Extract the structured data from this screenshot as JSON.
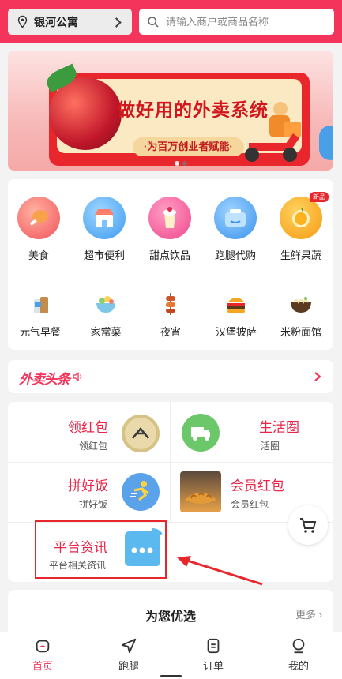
{
  "header": {
    "location": "银河公寓",
    "search_placeholder": "请输入商户或商品名称"
  },
  "banner": {
    "title": "做好用的外卖系统",
    "subtitle": "·为百万创业者赋能·"
  },
  "categories": [
    {
      "label": "美食"
    },
    {
      "label": "超市便利"
    },
    {
      "label": "甜点饮品"
    },
    {
      "label": "跑腿代购"
    },
    {
      "label": "生鲜果蔬",
      "badge": "新品"
    },
    {
      "label": "元气早餐"
    },
    {
      "label": "家常菜"
    },
    {
      "label": "夜宵"
    },
    {
      "label": "汉堡披萨"
    },
    {
      "label": "米粉面馆"
    }
  ],
  "news": {
    "logo": "外卖头条"
  },
  "promos": [
    {
      "title": "领红包",
      "sub": "领红包"
    },
    {
      "title": "生活圈",
      "sub": "活圈"
    },
    {
      "title": "拼好饭",
      "sub": "拼好饭"
    },
    {
      "title": "会员红包",
      "sub": "会员红包"
    },
    {
      "title": "平台资讯",
      "sub": "平台相关资讯"
    }
  ],
  "recommend": {
    "title": "为您优选",
    "more": "更多"
  },
  "tabs": [
    {
      "label": "首页",
      "icon": "home-icon",
      "active": true
    },
    {
      "label": "跑腿",
      "icon": "send-icon"
    },
    {
      "label": "订单",
      "icon": "order-icon"
    },
    {
      "label": "我的",
      "icon": "profile-icon"
    }
  ],
  "colors": {
    "brand": "#f4345b",
    "promo_title": "#e8264a",
    "highlight": "#e8262b"
  }
}
